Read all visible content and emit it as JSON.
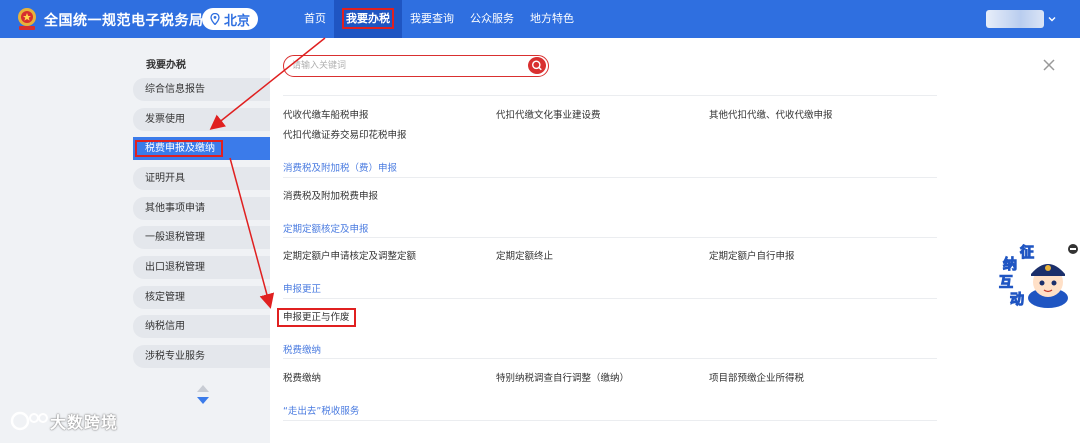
{
  "header": {
    "site_title": "全国统一规范电子税务局",
    "region": "北京",
    "nav": [
      {
        "label": "首页"
      },
      {
        "label": "我要办税"
      },
      {
        "label": "我要查询"
      },
      {
        "label": "公众服务"
      },
      {
        "label": "地方特色"
      }
    ]
  },
  "sidebar": {
    "title": "我要办税",
    "items": [
      {
        "label": "综合信息报告"
      },
      {
        "label": "发票使用"
      },
      {
        "label": "税费申报及缴纳"
      },
      {
        "label": "证明开具"
      },
      {
        "label": "其他事项申请"
      },
      {
        "label": "一般退税管理"
      },
      {
        "label": "出口退税管理"
      },
      {
        "label": "核定管理"
      },
      {
        "label": "纳税信用"
      },
      {
        "label": "涉税专业服务"
      }
    ]
  },
  "search": {
    "placeholder": "请输入关键词"
  },
  "content": {
    "links_top": [
      "代收代缴车船税申报",
      "代扣代缴文化事业建设费",
      "其他代扣代缴、代收代缴申报",
      "代扣代缴证券交易印花税申报"
    ],
    "sections": [
      {
        "title": "消费税及附加税（费）申报",
        "links": [
          "消费税及附加税费申报"
        ]
      },
      {
        "title": "定期定额核定及申报",
        "links": [
          "定期定额户申请核定及调整定额",
          "定期定额终止",
          "定期定额户自行申报"
        ]
      },
      {
        "title": "申报更正",
        "links": [
          "申报更正与作废"
        ]
      },
      {
        "title": "税费缴纳",
        "links": [
          "税费缴纳",
          "特别纳税调查自行调整（缴纳）",
          "项目部预缴企业所得税"
        ]
      },
      {
        "title": "“走出去”税收服务",
        "links": []
      }
    ]
  },
  "mascot": {
    "chars": [
      "征",
      "纳",
      "互",
      "动"
    ]
  },
  "watermark": {
    "text": "大数跨境"
  },
  "colors": {
    "primary": "#2f6fe0",
    "accent_red": "#e02020",
    "link_blue": "#4a7be0"
  }
}
